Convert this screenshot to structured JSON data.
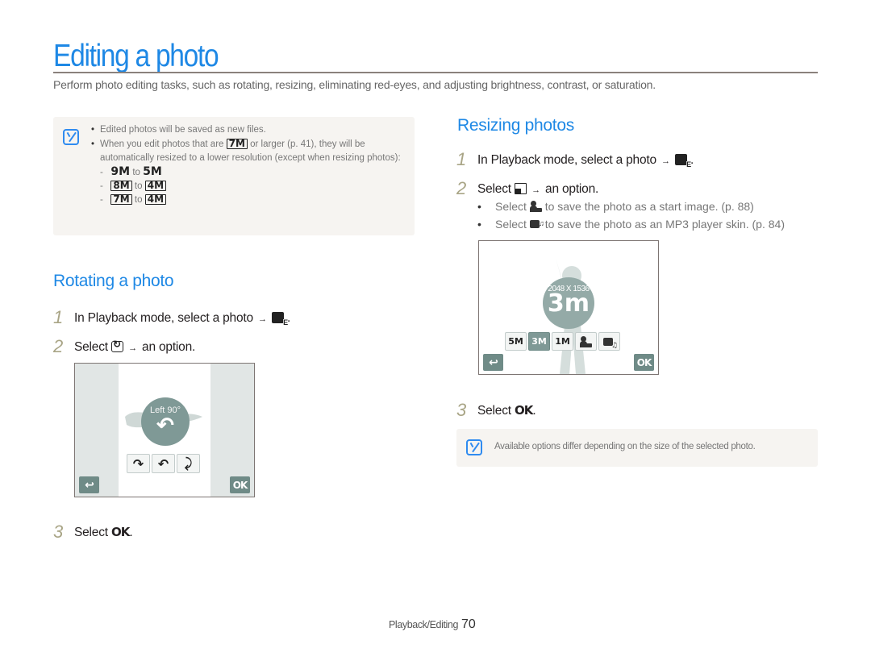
{
  "page": {
    "title": "Editing a photo",
    "intro": "Perform photo editing tasks, such as rotating, resizing, eliminating red-eyes, and adjusting brightness, contrast, or saturation.",
    "accent_color": "#1e88e5"
  },
  "note_top": {
    "icon": "note-icon",
    "items": [
      {
        "text": "Edited photos will be saved as new files."
      },
      {
        "text_before": "When you edit photos that are ",
        "icon_label": "7M",
        "text_after": " or larger (p. 41), they will be automatically resized to a lower resolution (except when resizing photos):"
      }
    ],
    "conversions": [
      {
        "from": "9M",
        "connector": "to",
        "to": "5M"
      },
      {
        "from": "8M",
        "connector": "to",
        "to": "4M"
      },
      {
        "from": "7M",
        "connector": "to",
        "to": "4M"
      }
    ]
  },
  "rotating": {
    "heading": "Rotating a photo",
    "steps": [
      {
        "num": "1",
        "text": "In Playback mode, select a photo",
        "icon": "edit-icon",
        "suffix": "."
      },
      {
        "num": "2",
        "text": "Select",
        "icon": "rotate-icon",
        "suffix": "an option."
      },
      {
        "num": "3",
        "text": "Select",
        "icon_label": "OK",
        "suffix": "."
      }
    ],
    "screen": {
      "circle_label": "Left 90°",
      "options": [
        "rotate-right-icon",
        "rotate-left-icon",
        "flip-icon"
      ],
      "back_label": "back-icon",
      "ok_label": "OK"
    }
  },
  "resizing": {
    "heading": "Resizing photos",
    "steps": [
      {
        "num": "1",
        "text": "In Playback mode, select a photo",
        "icon": "edit-icon",
        "suffix": "."
      },
      {
        "num": "2",
        "text": "Select",
        "icon": "resize-icon",
        "suffix": "an option."
      },
      {
        "num": "3",
        "text": "Select",
        "icon_label": "OK",
        "suffix": "."
      }
    ],
    "bullets": [
      {
        "before": "Select ",
        "icon": "start-image-icon",
        "after": " to save the photo as a start image. (p. 88)"
      },
      {
        "before": "Select ",
        "icon": "mp3-skin-icon",
        "after": " to save the photo as an MP3 player skin. (p. 84)"
      }
    ],
    "screen": {
      "resolution": "2048 X 1536",
      "big_size": "3m",
      "options": [
        {
          "label": "5M",
          "selected": false
        },
        {
          "label": "3M",
          "selected": true
        },
        {
          "label": "1M",
          "selected": false
        },
        {
          "label": "start-image-icon",
          "selected": false
        },
        {
          "label": "mp3-skin-icon",
          "selected": false
        }
      ],
      "ok_label": "OK"
    }
  },
  "note_bottom": {
    "text": "Available options differ depending on the size of the selected photo."
  },
  "footer": {
    "section": "Playback/Editing",
    "page_number": "70"
  },
  "arrow": "→"
}
